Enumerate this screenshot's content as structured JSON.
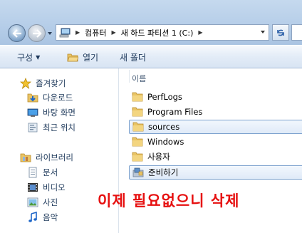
{
  "address_bar": {
    "breadcrumbs": [
      "컴퓨터",
      "새 하드 파티션 1 (C:)"
    ],
    "icon": "computer-icon"
  },
  "toolbar": {
    "organize_label": "구성",
    "open_label": "열기",
    "new_folder_label": "새 폴더"
  },
  "navigation": {
    "favorites": {
      "label": "즐겨찾기",
      "items": [
        {
          "label": "다운로드",
          "icon": "downloads-folder-icon"
        },
        {
          "label": "바탕 화면",
          "icon": "desktop-icon"
        },
        {
          "label": "최근 위치",
          "icon": "recent-places-icon"
        }
      ]
    },
    "libraries": {
      "label": "라이브러리",
      "items": [
        {
          "label": "문서",
          "icon": "documents-icon"
        },
        {
          "label": "비디오",
          "icon": "videos-icon"
        },
        {
          "label": "사진",
          "icon": "pictures-icon"
        },
        {
          "label": "음악",
          "icon": "music-icon"
        }
      ]
    }
  },
  "file_list": {
    "column_name": "이름",
    "items": [
      {
        "name": "PerfLogs",
        "icon": "folder-icon",
        "selected": false
      },
      {
        "name": "Program Files",
        "icon": "folder-icon",
        "selected": false
      },
      {
        "name": "sources",
        "icon": "folder-icon",
        "selected": true
      },
      {
        "name": "Windows",
        "icon": "folder-icon",
        "selected": false
      },
      {
        "name": "사용자",
        "icon": "folder-icon",
        "selected": false
      },
      {
        "name": "준비하기",
        "icon": "setup-folder-icon",
        "selected": true
      }
    ]
  },
  "annotation_text": "이제 필요없으니 삭제",
  "colors": {
    "annotation": "#e60f0f",
    "folder": "#e9c465",
    "selection_border": "#7da2ce"
  }
}
